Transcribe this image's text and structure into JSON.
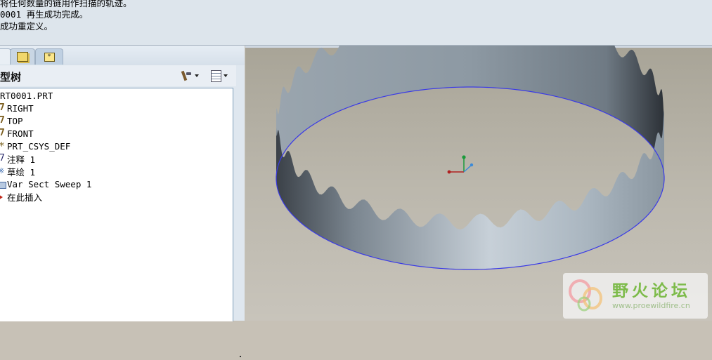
{
  "messages": [
    "将任何数量的链用作扫描的轨迹。",
    "0001 再生成功完成。",
    "成功重定义。"
  ],
  "panel": {
    "title": "模型树",
    "visible_title": "型树",
    "tabs": [
      {
        "icon": "model-tree-tab-icon"
      },
      {
        "icon": "folder-browser-tab-icon"
      },
      {
        "icon": "favorites-tab-icon"
      }
    ]
  },
  "model_tree": {
    "items": [
      {
        "label": "RT0001.PRT",
        "icon": "part-icon"
      },
      {
        "label": "RIGHT",
        "icon": "datum-plane-icon"
      },
      {
        "label": "TOP",
        "icon": "datum-plane-icon"
      },
      {
        "label": "FRONT",
        "icon": "datum-plane-icon"
      },
      {
        "label": "PRT_CSYS_DEF",
        "icon": "csys-icon"
      },
      {
        "label": "注释 1",
        "icon": "note-icon"
      },
      {
        "label": "草绘 1",
        "icon": "sketch-icon"
      },
      {
        "label": "Var Sect Sweep 1",
        "icon": "sweep-icon"
      },
      {
        "label": "在此插入",
        "icon": "insert-here-icon"
      }
    ]
  },
  "watermark": {
    "title": "野火论坛",
    "url": "www.proewildfire.cn"
  },
  "colors": {
    "message_bg": "#dde5ec",
    "panel_bg": "#dfe7ef",
    "viewport_bg": "#bbb7ac",
    "edge_blue": "#3a3ae6",
    "watermark_green": "#7dbb4a"
  }
}
